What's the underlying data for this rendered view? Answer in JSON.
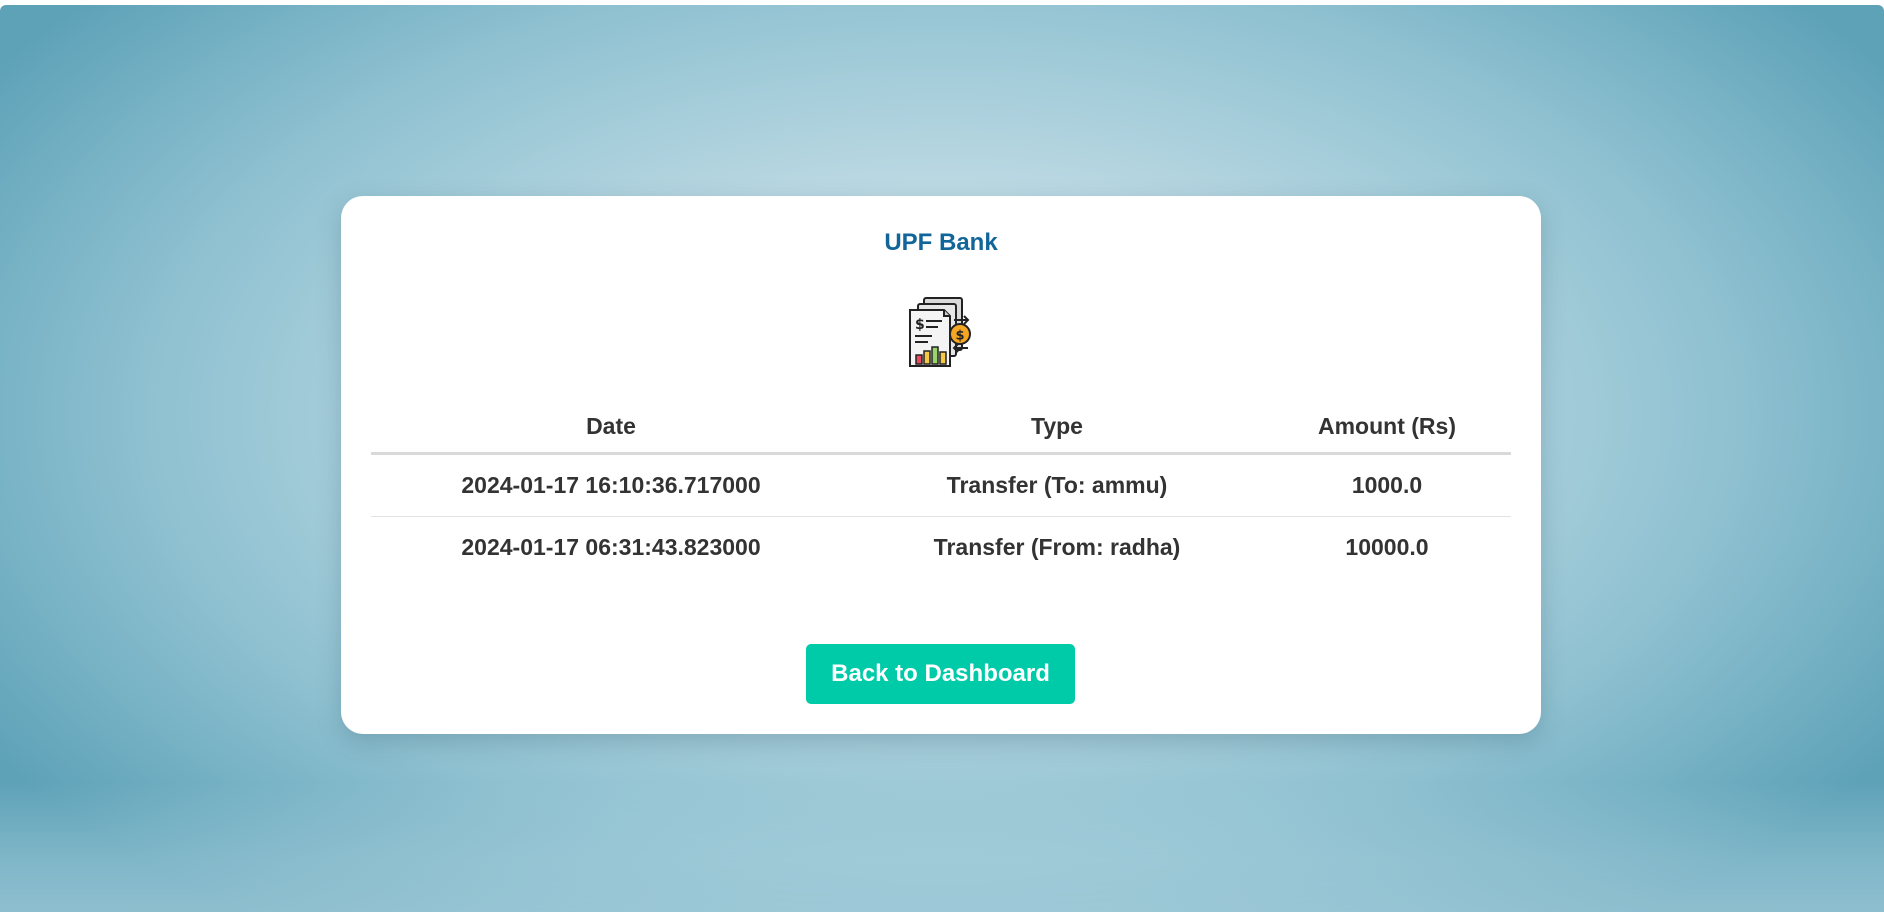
{
  "card": {
    "title": "UPF Bank",
    "icon": "financial-report-icon"
  },
  "table": {
    "headers": {
      "date": "Date",
      "type": "Type",
      "amount": "Amount (Rs)"
    },
    "rows": [
      {
        "date": "2024-01-17 16:10:36.717000",
        "type": "Transfer (To: ammu)",
        "amount": "1000.0"
      },
      {
        "date": "2024-01-17 06:31:43.823000",
        "type": "Transfer (From: radha)",
        "amount": "10000.0"
      }
    ]
  },
  "actions": {
    "back_label": "Back to Dashboard"
  },
  "colors": {
    "title": "#116699",
    "button": "#00cba9",
    "text": "#333333"
  }
}
